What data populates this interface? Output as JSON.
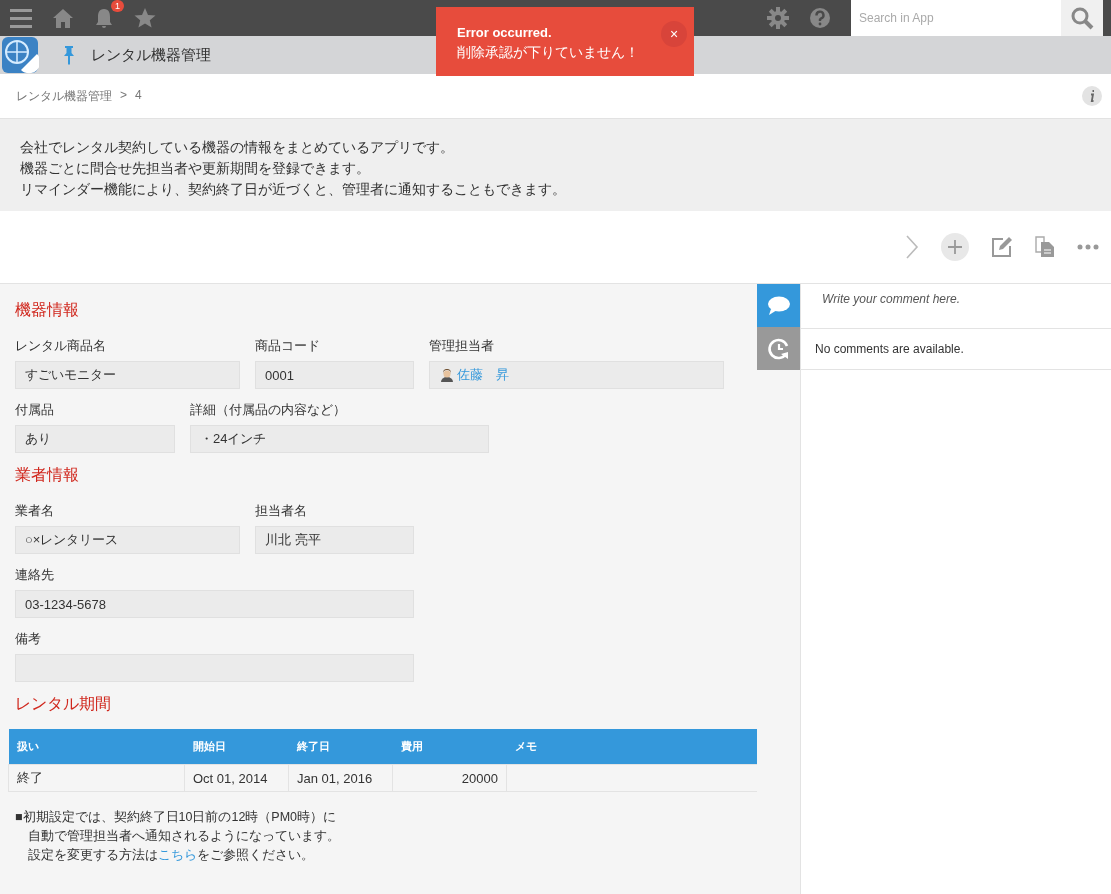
{
  "topbar": {
    "notification_count": "1",
    "search": {
      "placeholder": "Search in App"
    }
  },
  "app_header": {
    "title": "レンタル機器管理"
  },
  "toast": {
    "title": "Error occurred.",
    "message": "削除承認が下りていません！",
    "close": "×"
  },
  "breadcrumb": {
    "items": [
      "レンタル機器管理",
      "4"
    ],
    "separator": ">"
  },
  "description": [
    "会社でレンタル契約している機器の情報をまとめているアプリです。",
    "機器ごとに問合せ先担当者や更新期間を登録できます。",
    "リマインダー機能により、契約終了日が近づくと、管理者に通知することもできます。"
  ],
  "sections": [
    {
      "title": "機器情報",
      "rows": [
        [
          {
            "label": "レンタル商品名",
            "value": "すごいモニター",
            "kind": "text"
          },
          {
            "label": "商品コード",
            "value": "0001",
            "kind": "text"
          },
          {
            "label": "管理担当者",
            "value": "佐藤　昇",
            "kind": "user"
          }
        ],
        [
          {
            "label": "付属品",
            "value": "あり",
            "kind": "text"
          },
          {
            "label": "詳細（付属品の内容など）",
            "value": "・24インチ",
            "kind": "text"
          }
        ]
      ]
    },
    {
      "title": "業者情報",
      "rows": [
        [
          {
            "label": "業者名",
            "value": "○×レンタリース",
            "kind": "text"
          },
          {
            "label": "担当者名",
            "value": "川北 亮平",
            "kind": "text"
          }
        ],
        [
          {
            "label": "連絡先",
            "value": "03-1234-5678",
            "kind": "text"
          }
        ],
        [
          {
            "label": "備考",
            "kind": "text"
          }
        ]
      ]
    }
  ],
  "table": {
    "title": "レンタル期間",
    "columns": [
      "扱い",
      "開始日",
      "終了日",
      "費用",
      "メモ"
    ],
    "rows": [
      [
        "終了",
        "Oct 01, 2014",
        "Jan 01, 2016",
        "20000",
        ""
      ]
    ]
  },
  "note": {
    "lines": [
      "■初期設定では、契約終了日10日前の12時（PM0時）に",
      "自動で管理担当者へ通知されるようになっています。"
    ],
    "before": "設定を変更する方法は",
    "link": "こちら",
    "after": "をご参照ください。"
  },
  "comments": {
    "placeholder": "Write your comment here.",
    "empty": "No comments are available."
  }
}
